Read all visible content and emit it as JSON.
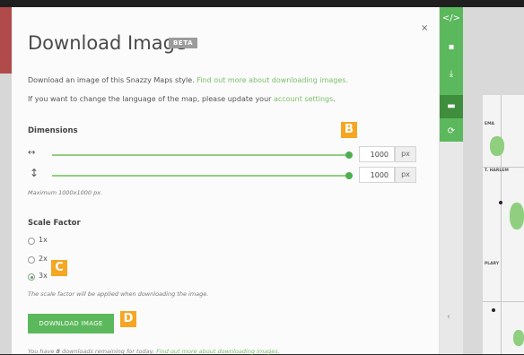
{
  "modal": {
    "title": "Download Image",
    "badge": "BETA",
    "close": "×",
    "intro": {
      "text": "Download an image of this Snazzy Maps style. ",
      "link": "Find out more about downloading images."
    },
    "language": {
      "text": "If you want to change the language of the map, please update your ",
      "link": "account settings",
      "end": "."
    },
    "dimensions": {
      "heading": "Dimensions",
      "width": {
        "icon": "horizontal-arrows-icon",
        "glyph": "↔",
        "value": "1000",
        "unit": "px",
        "slider_fraction": 1.0
      },
      "height": {
        "icon": "vertical-arrows-icon",
        "glyph": "↕",
        "value": "1000",
        "unit": "px",
        "slider_fraction": 1.0
      },
      "max_note": "Maximum 1000x1000 px."
    },
    "scale": {
      "heading": "Scale Factor",
      "options": [
        "1x",
        "2x",
        "3x"
      ],
      "selected": "3x",
      "note": "The scale factor will be applied when downloading the image."
    },
    "download_button": "DOWNLOAD IMAGE",
    "remaining": {
      "text_pre": "You have ",
      "count": "8",
      "text_post": " downloads remaining for today. ",
      "link": "Find out more about downloading images."
    }
  },
  "callouts": {
    "b": "B",
    "c": "C",
    "d": "D"
  },
  "toolbar": {
    "items": [
      {
        "icon": "code-icon",
        "glyph": "</>"
      },
      {
        "icon": "save-icon",
        "glyph": "▪"
      },
      {
        "icon": "download-icon",
        "glyph": "⤓"
      },
      {
        "icon": "image-icon",
        "glyph": "▬"
      },
      {
        "icon": "refresh-icon",
        "glyph": "⟳"
      }
    ],
    "collapse": "‹"
  },
  "map": {
    "labels": [
      "EMA",
      "T. HARLEM",
      "PLARY"
    ]
  },
  "colors": {
    "accent": "#5cb85c",
    "link": "#7bbf6a",
    "callout": "#f5a623"
  }
}
